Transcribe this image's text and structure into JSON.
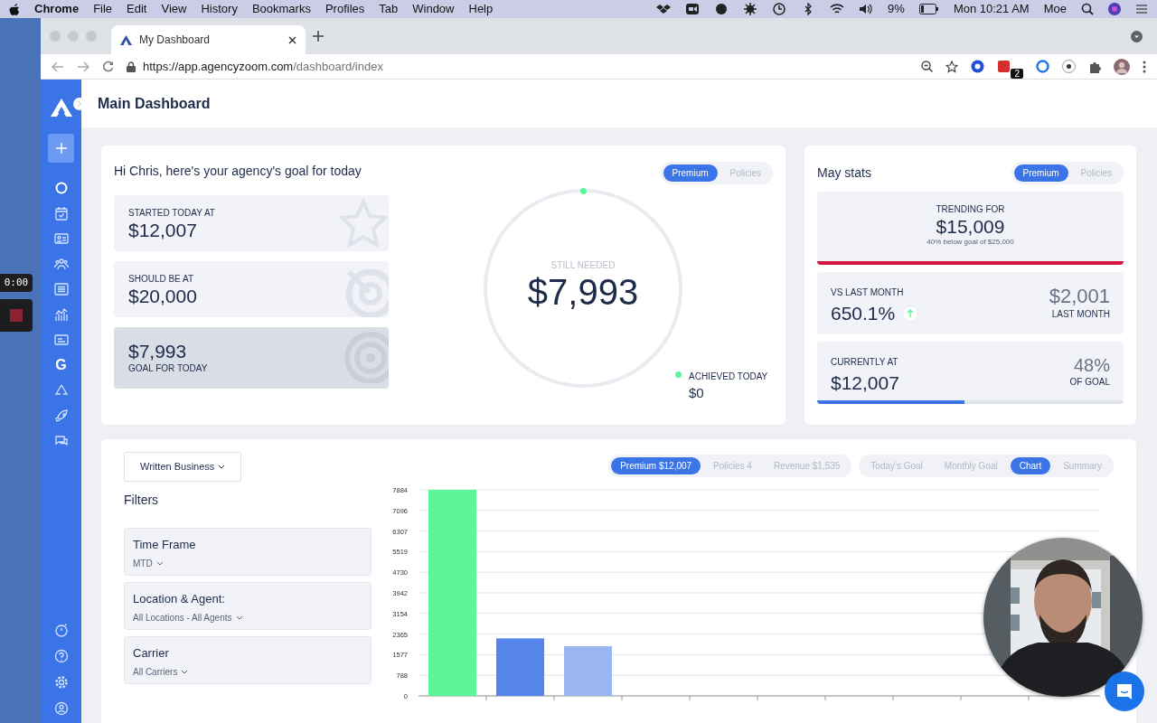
{
  "menubar": {
    "app": "Chrome",
    "menus": [
      "File",
      "Edit",
      "View",
      "History",
      "Bookmarks",
      "Profiles",
      "Tab",
      "Window",
      "Help"
    ],
    "battery": "9%",
    "clock": "Mon 10:21 AM",
    "user": "Moe"
  },
  "recorder": {
    "timer": "0:00"
  },
  "browser": {
    "tab_title": "My Dashboard",
    "url_host": "https://app.agencyzoom.com",
    "url_path": "/dashboard/index",
    "extension_badge": "2"
  },
  "sidebar": {
    "letter_item": "G"
  },
  "page_title": "Main Dashboard",
  "goal": {
    "title": "Hi Chris, here's your agency's goal for today",
    "toggle": [
      {
        "label": "Premium",
        "selected": true
      },
      {
        "label": "Policies",
        "selected": false
      }
    ],
    "stats": [
      {
        "label": "STARTED TODAY AT",
        "value": "$12,007",
        "highlighted": false
      },
      {
        "label": "SHOULD BE AT",
        "value": "$20,000",
        "highlighted": false
      },
      {
        "label": "GOAL FOR TODAY",
        "value": "$7,993",
        "highlighted": true
      }
    ],
    "ring": {
      "label": "STILL NEEDED",
      "value": "$7,993"
    },
    "achieved": {
      "label": "ACHIEVED TODAY",
      "value": "$0"
    }
  },
  "may_stats": {
    "title": "May stats",
    "toggle": [
      {
        "label": "Premium",
        "selected": true
      },
      {
        "label": "Policies",
        "selected": false
      }
    ],
    "trending": {
      "label": "TRENDING FOR",
      "value": "$15,009",
      "note": "40% below goal of $25,000"
    },
    "vs_last_month": {
      "label": "VS LAST MONTH",
      "value": "650.1%",
      "last_value": "$2,001",
      "last_label": "LAST MONTH"
    },
    "current": {
      "label": "CURRENTLY AT",
      "value": "$12,007",
      "percent": "48%",
      "percent_label": "OF GOAL",
      "level": 0.48
    }
  },
  "bottom": {
    "dropdown": "Written Business",
    "filters_title": "Filters",
    "filters": [
      {
        "label": "Time Frame",
        "value": "MTD"
      },
      {
        "label": "Location & Agent:",
        "value": "All Locations - All Agents"
      },
      {
        "label": "Carrier",
        "value": "All Carriers"
      }
    ],
    "metric_tabs": [
      {
        "label": "Premium $12,007",
        "selected": true
      },
      {
        "label": "Policies 4",
        "selected": false
      },
      {
        "label": "Revenue $1,535",
        "selected": false
      }
    ],
    "view_tabs": [
      {
        "label": "Today's Goal",
        "selected": false
      },
      {
        "label": "Monthly Goal",
        "selected": false
      },
      {
        "label": "Chart",
        "selected": true
      },
      {
        "label": "Summary",
        "selected": false
      }
    ],
    "chart_data": {
      "type": "bar",
      "grid": true,
      "values": [
        7884,
        2200,
        1900,
        null,
        null,
        null,
        null,
        null,
        null,
        null
      ],
      "colors": [
        "#5ef59a",
        "#5585e8",
        "#9ab6f3",
        null,
        null,
        null,
        null,
        null,
        null,
        null
      ],
      "ylim": [
        0,
        7884
      ],
      "yticks": [
        0,
        788,
        1577,
        2365,
        3154,
        3942,
        4730,
        5519,
        6307,
        7096,
        7884
      ]
    }
  }
}
